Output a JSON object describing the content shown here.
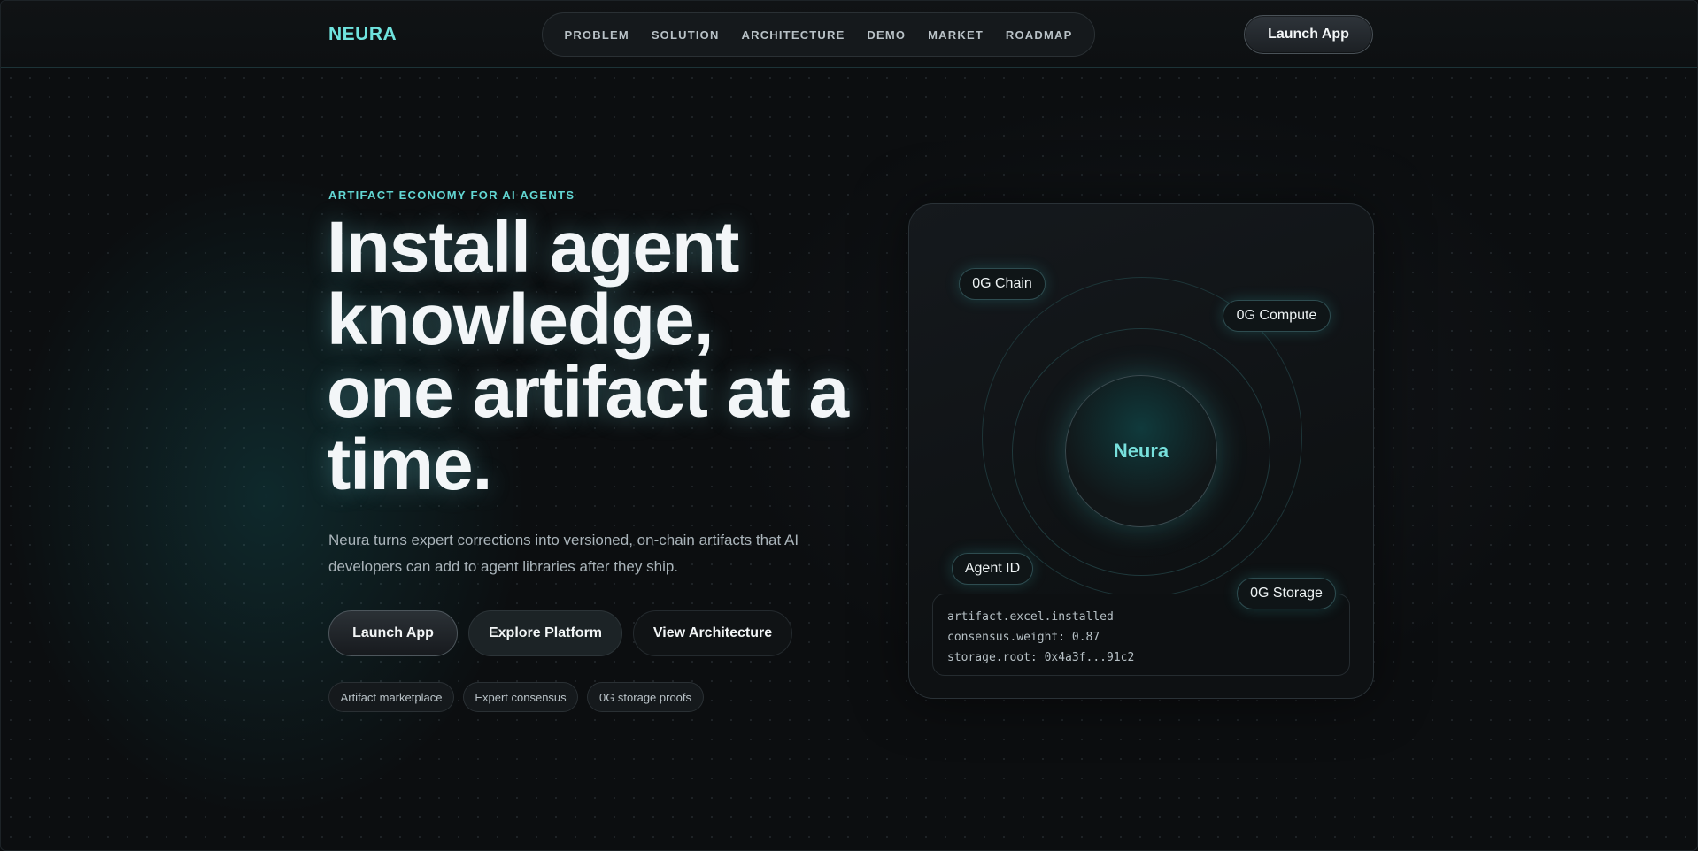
{
  "header": {
    "logo": "NEURA",
    "nav": [
      "PROBLEM",
      "SOLUTION",
      "ARCHITECTURE",
      "DEMO",
      "MARKET",
      "ROADMAP"
    ],
    "launch_label": "Launch App"
  },
  "hero": {
    "eyebrow": "ARTIFACT ECONOMY FOR AI AGENTS",
    "headline_lines": [
      "Install agent",
      "knowledge,",
      "one artifact at a",
      "time."
    ],
    "subtext": "Neura turns expert corrections into versioned, on-chain artifacts that AI developers can add to agent libraries after they ship.",
    "cta": {
      "launch": "Launch App",
      "explore": "Explore Platform",
      "architecture": "View Architecture"
    },
    "tags": [
      "Artifact marketplace",
      "Expert consensus",
      "0G storage proofs"
    ]
  },
  "diagram": {
    "center": "Neura",
    "nodes": {
      "chain": "0G Chain",
      "compute": "0G Compute",
      "agent_id": "Agent ID",
      "storage": "0G Storage"
    },
    "console_lines": [
      "artifact.excel.installed",
      "consensus.weight: 0.87",
      "storage.root: 0x4a3f...91c2"
    ]
  },
  "colors": {
    "accent": "#6fe3de",
    "background": "#0c0e10"
  }
}
